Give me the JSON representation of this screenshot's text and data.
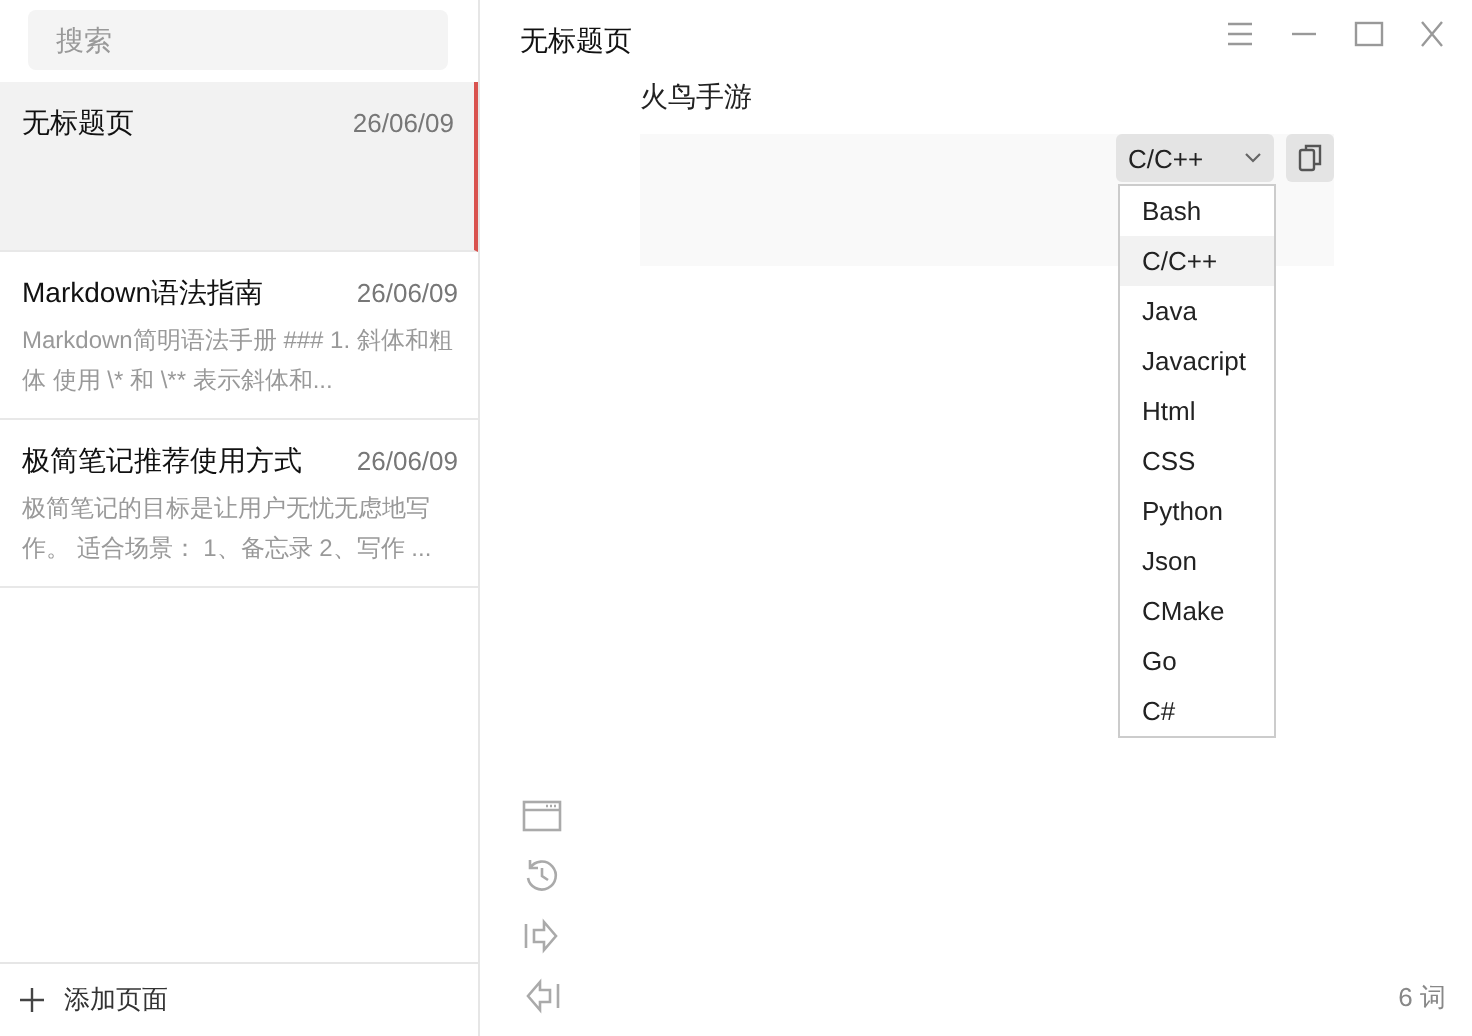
{
  "sidebar": {
    "search": {
      "placeholder": "搜索"
    },
    "notes": [
      {
        "title": "无标题页",
        "date": "26/06/09",
        "selected": true
      },
      {
        "title": "Markdown语法指南",
        "date": "26/06/09",
        "preview": "Markdown简明语法手册  ### 1. 斜体和粗体  使用 \\* 和 \\** 表示斜体和...",
        "selected": false
      },
      {
        "title": "极简笔记推荐使用方式",
        "date": "26/06/09",
        "preview": "极简笔记的目标是让用户无忧无虑地写作。  适合场景：  1、备忘录  2、写作 ...",
        "selected": false
      }
    ],
    "add_page": "添加页面"
  },
  "editor": {
    "title": "无标题页",
    "paragraph": "火鸟手游",
    "code_block": {
      "language": "C/C++",
      "menu": [
        {
          "label": "Bash",
          "selected": false
        },
        {
          "label": "C/C++",
          "selected": true
        },
        {
          "label": "Java",
          "selected": false
        },
        {
          "label": "Javacript",
          "selected": false
        },
        {
          "label": "Html",
          "selected": false
        },
        {
          "label": "CSS",
          "selected": false
        },
        {
          "label": "Python",
          "selected": false
        },
        {
          "label": "Json",
          "selected": false
        },
        {
          "label": "CMake",
          "selected": false
        },
        {
          "label": "Go",
          "selected": false
        },
        {
          "label": "C#",
          "selected": false
        }
      ]
    },
    "word_count": "6 词"
  }
}
